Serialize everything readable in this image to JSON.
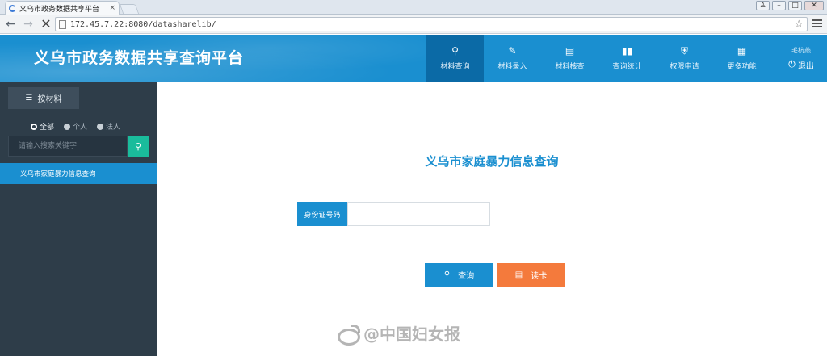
{
  "browser": {
    "tab_title": "义乌市政务数据共享平台",
    "tab_close": "×",
    "url": "172.45.7.22:8080/datasharelib/",
    "window_buttons": [
      "♙",
      "–",
      "□",
      "✕"
    ]
  },
  "header": {
    "title": "义乌市政务数据共享查询平台",
    "menu": [
      {
        "label": "材料查询",
        "icon": "search-icon",
        "glyph": "●",
        "active": true
      },
      {
        "label": "材料录入",
        "icon": "edit-icon",
        "glyph": "✎",
        "active": false
      },
      {
        "label": "材料核查",
        "icon": "card-icon",
        "glyph": "▤",
        "active": false
      },
      {
        "label": "查询统计",
        "icon": "bar-chart-icon",
        "glyph": "▐",
        "active": false
      },
      {
        "label": "权限申请",
        "icon": "shield-icon",
        "glyph": "⛨",
        "active": false
      },
      {
        "label": "更多功能",
        "icon": "grid-icon",
        "glyph": "▦",
        "active": false
      }
    ],
    "user_name": "毛杭燕",
    "logout_label": "退出"
  },
  "sidebar": {
    "tab_label": "按材料",
    "radios": [
      {
        "label": "全部",
        "checked": true
      },
      {
        "label": "个人",
        "checked": false
      },
      {
        "label": "法人",
        "checked": false
      }
    ],
    "search_placeholder": "请输入搜索关键字",
    "items": [
      {
        "label": "义乌市家庭暴力信息查询",
        "active": true
      }
    ]
  },
  "main": {
    "title": "义乌市家庭暴力信息查询",
    "id_label": "身份证号码",
    "id_value": "",
    "query_button": "查询",
    "readcard_button": "读卡"
  },
  "watermark": {
    "text": "@中国妇女报"
  },
  "colors": {
    "primary": "#1a8fd0",
    "sidebar": "#2e3d49",
    "accent_green": "#1abc9c",
    "accent_orange": "#f47a3c"
  }
}
